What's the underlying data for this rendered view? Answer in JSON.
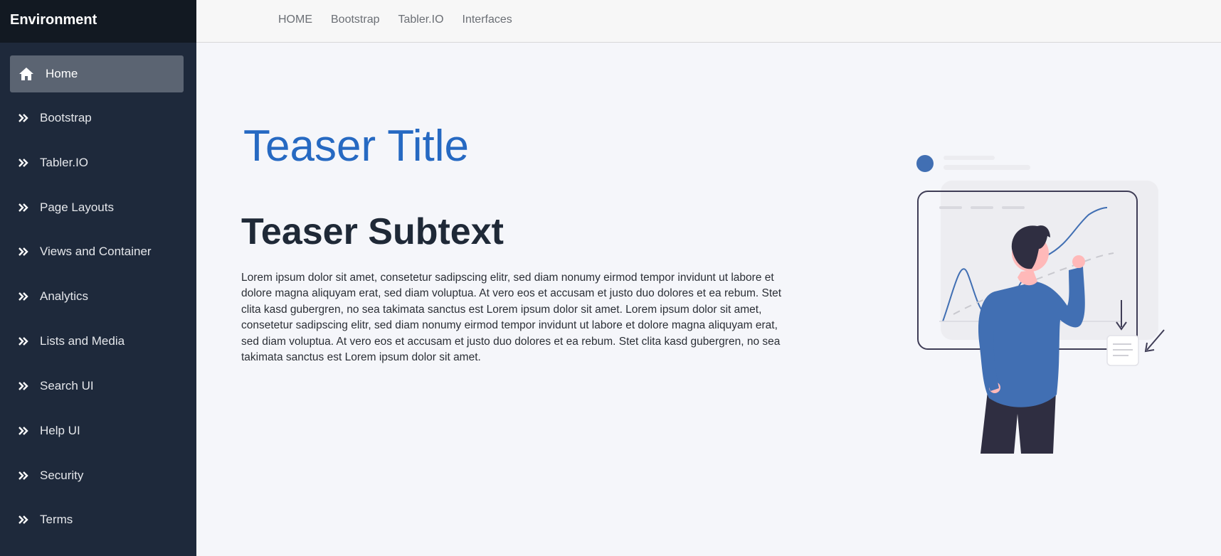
{
  "brand": {
    "name": "Environment"
  },
  "sidebar": {
    "items": [
      {
        "label": "Home",
        "icon": "home-icon",
        "active": true
      },
      {
        "label": "Bootstrap",
        "icon": "double-chevron-right-icon"
      },
      {
        "label": "Tabler.IO",
        "icon": "double-chevron-right-icon"
      },
      {
        "label": "Page Layouts",
        "icon": "double-chevron-right-icon"
      },
      {
        "label": "Views and Container",
        "icon": "double-chevron-right-icon"
      },
      {
        "label": "Analytics",
        "icon": "double-chevron-right-icon"
      },
      {
        "label": "Lists and Media",
        "icon": "double-chevron-right-icon"
      },
      {
        "label": "Search UI",
        "icon": "double-chevron-right-icon"
      },
      {
        "label": "Help UI",
        "icon": "double-chevron-right-icon"
      },
      {
        "label": "Security",
        "icon": "double-chevron-right-icon"
      },
      {
        "label": "Terms",
        "icon": "double-chevron-right-icon"
      }
    ]
  },
  "topnav": {
    "items": [
      "HOME",
      "Bootstrap",
      "Tabler.IO",
      "Interfaces"
    ]
  },
  "main": {
    "title": "Teaser Title",
    "subtitle": "Teaser Subtext",
    "body": "Lorem ipsum dolor sit amet, consetetur sadipscing elitr, sed diam nonumy eirmod tempor invidunt ut labore et dolore magna aliquyam erat, sed diam voluptua. At vero eos et accusam et justo duo dolores et ea rebum. Stet clita kasd gubergren, no sea takimata sanctus est Lorem ipsum dolor sit amet. Lorem ipsum dolor sit amet, consetetur sadipscing elitr, sed diam nonumy eirmod tempor invidunt ut labore et dolore magna aliquyam erat, sed diam voluptua. At vero eos et accusam et justo duo dolores et ea rebum. Stet clita kasd gubergren, no sea takimata sanctus est Lorem ipsum dolor sit amet."
  },
  "colors": {
    "sidebar_bg": "#1e293b",
    "brand_bg": "#121922",
    "active_item_bg": "#5b6472",
    "title_blue": "#2669c2",
    "illustration_blue": "#416fb3",
    "dark_navy": "#2f2e41"
  }
}
